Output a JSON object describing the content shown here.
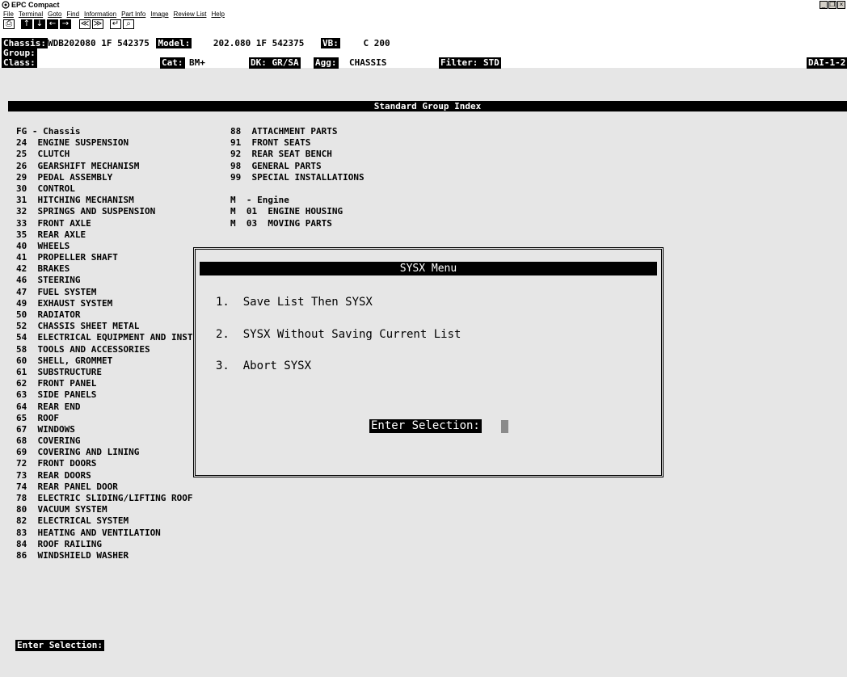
{
  "window": {
    "title": "EPC Compact"
  },
  "menu": [
    "File",
    "Terminal",
    "Goto",
    "Find",
    "Information",
    "Part Info",
    "Image",
    "Review List",
    "Help"
  ],
  "toolbar": {
    "print": "⎙",
    "up": "↑",
    "down": "↓",
    "left": "←",
    "right": "→",
    "first": "≪",
    "last": "≫",
    "enter": "↵",
    "zoom": "⌕"
  },
  "header": {
    "chassis_label": "Chassis:",
    "chassis_value": "WDB202080 1F 542375",
    "model_label": "Model:",
    "model_value": "202.080 1F 542375",
    "vb_label": "VB:",
    "vb_value": "C 200",
    "group_label": "Group:",
    "class_label": "Class:",
    "cat_label": "Cat:",
    "cat_value": "BM+",
    "dk_value": "DK: GR/SA",
    "agg_label": "Agg:",
    "agg_value": "CHASSIS",
    "filter_value": "Filter: STD",
    "code_value": "DAI-1-2"
  },
  "index_title": "Standard Group Index",
  "groups_col1": [
    "FG - Chassis",
    "24  ENGINE SUSPENSION",
    "25  CLUTCH",
    "26  GEARSHIFT MECHANISM",
    "29  PEDAL ASSEMBLY",
    "30  CONTROL",
    "31  HITCHING MECHANISM",
    "32  SPRINGS AND SUSPENSION",
    "33  FRONT AXLE",
    "35  REAR AXLE",
    "40  WHEELS",
    "41  PROPELLER SHAFT",
    "42  BRAKES",
    "46  STEERING",
    "47  FUEL SYSTEM",
    "49  EXHAUST SYSTEM",
    "50  RADIATOR",
    "52  CHASSIS SHEET METAL",
    "54  ELECTRICAL EQUIPMENT AND INST",
    "58  TOOLS AND ACCESSORIES",
    "60  SHELL, GROMMET",
    "61  SUBSTRUCTURE",
    "62  FRONT PANEL",
    "63  SIDE PANELS",
    "64  REAR END",
    "65  ROOF",
    "67  WINDOWS",
    "68  COVERING",
    "69  COVERING AND LINING",
    "72  FRONT DOORS",
    "73  REAR DOORS",
    "74  REAR PANEL DOOR",
    "78  ELECTRIC SLIDING/LIFTING ROOF",
    "80  VACUUM SYSTEM",
    "82  ELECTRICAL SYSTEM",
    "83  HEATING AND VENTILATION",
    "84  ROOF RAILING",
    "86  WINDSHIELD WASHER"
  ],
  "groups_col2": [
    "88  ATTACHMENT PARTS",
    "91  FRONT SEATS",
    "92  REAR SEAT BENCH",
    "98  GENERAL PARTS",
    "99  SPECIAL INSTALLATIONS",
    "",
    "M  - Engine",
    "M  01  ENGINE HOUSING",
    "M  03  MOVING PARTS"
  ],
  "dialog": {
    "title": "SYSX Menu",
    "option1": "1.  Save List Then SYSX",
    "option2": "2.  SYSX Without Saving Current List",
    "option3": "3.  Abort SYSX",
    "prompt": "Enter Selection:"
  },
  "bottom_prompt": "Enter Selection:"
}
